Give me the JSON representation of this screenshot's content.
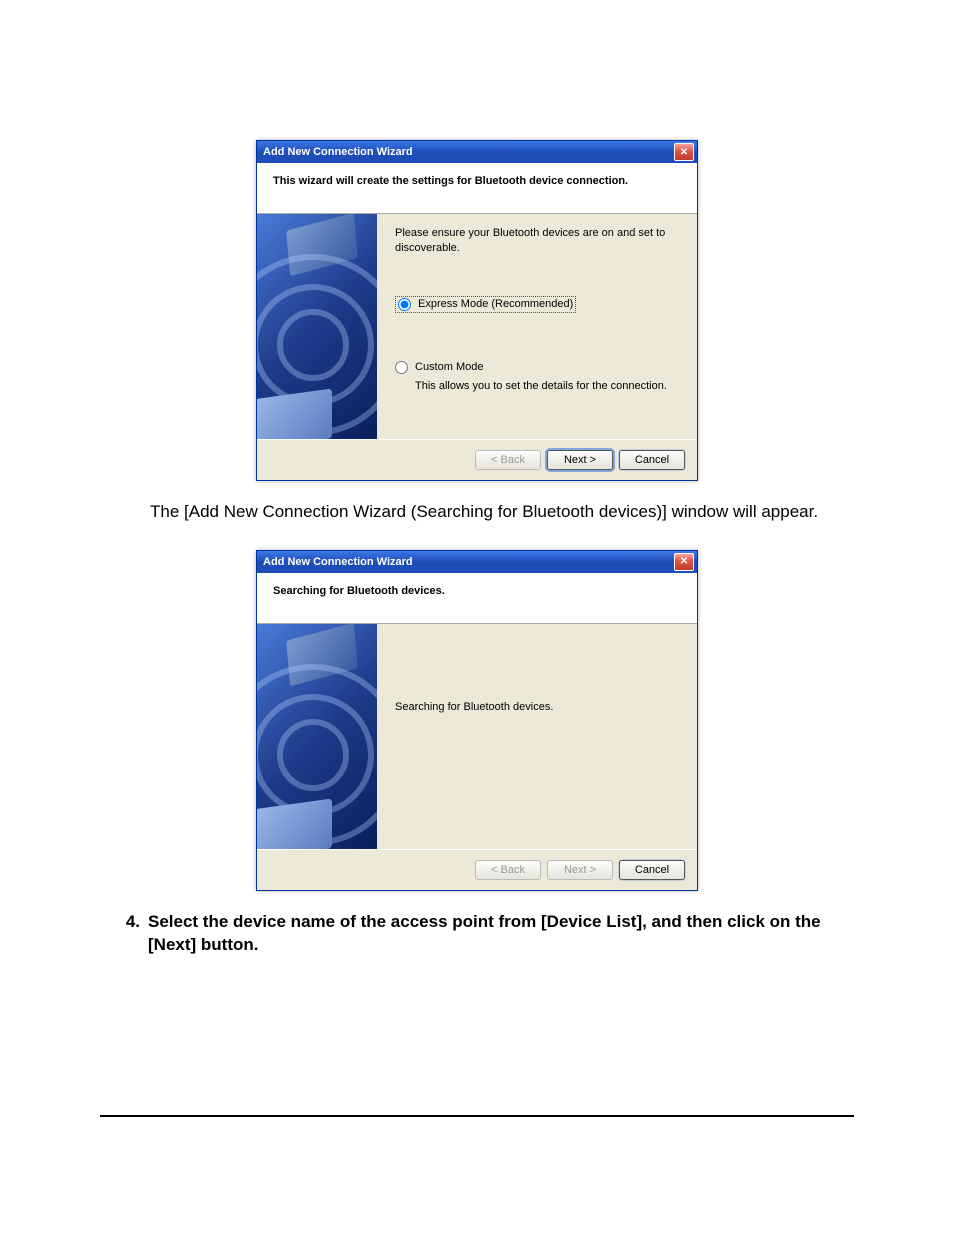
{
  "dialog1": {
    "title": "Add New Connection Wizard",
    "subheader": "This wizard will create the settings for Bluetooth device connection.",
    "instruction": "Please ensure your Bluetooth devices are on and set to discoverable.",
    "option_express": "Express Mode (Recommended)",
    "option_custom": "Custom Mode",
    "custom_desc": "This allows you to set the details for the connection.",
    "btn_back": "< Back",
    "btn_next": "Next >",
    "btn_cancel": "Cancel"
  },
  "between_text": "The [Add New Connection Wizard (Searching for Bluetooth devices)] window will appear.",
  "dialog2": {
    "title": "Add New Connection Wizard",
    "subheader": "Searching for Bluetooth devices.",
    "message": "Searching for Bluetooth devices.",
    "btn_back": "< Back",
    "btn_next": "Next >",
    "btn_cancel": "Cancel"
  },
  "step4": {
    "num": "4.",
    "text": "Select the device name of the access point from [Device List], and then click on the [Next] button."
  }
}
